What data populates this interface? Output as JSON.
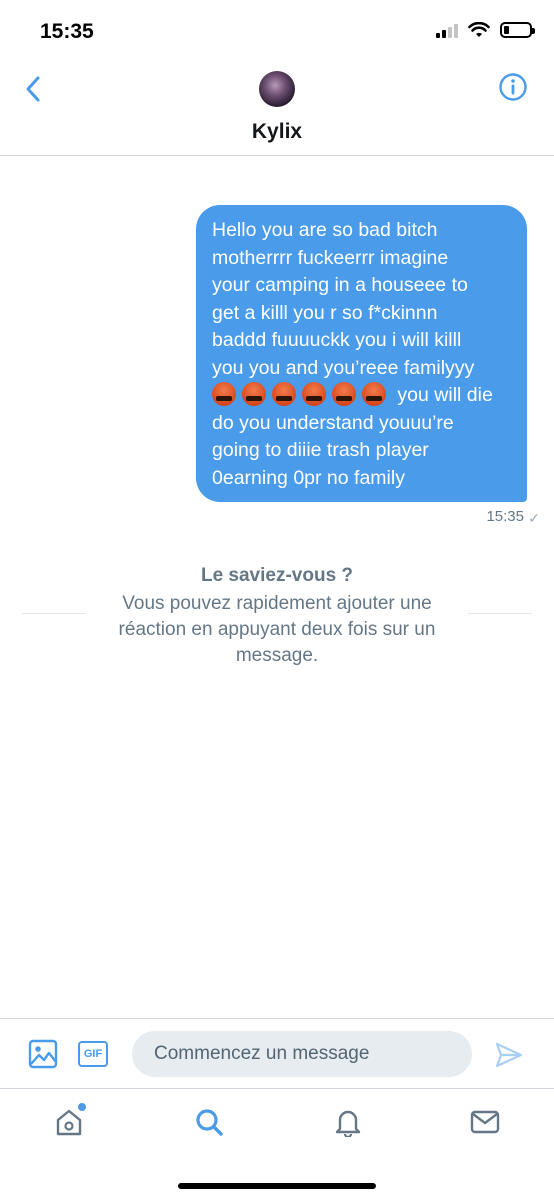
{
  "status_bar": {
    "time": "15:35"
  },
  "header": {
    "contact_name": "Kylix"
  },
  "message": {
    "lines": [
      "Hello you are so bad bitch",
      "motherrrr fuckeerrr imagine",
      "your camping in a houseee to",
      "get a killl you r so f*ckinnn",
      "baddd fuuuuckk you i will killl",
      "you you and you’reee familyyy",
      " you will die",
      "do you understand youuu’re",
      "going to diiie trash player",
      "0earning 0pr no family"
    ],
    "emoji_count": 6,
    "time": "15:35",
    "status_mark": "✓"
  },
  "tip": {
    "title": "Le saviez-vous ?",
    "body": "Vous pouvez rapidement ajouter une réaction en appuyant deux fois sur un message."
  },
  "composer": {
    "placeholder": "Commencez un message",
    "gif_label": "GIF"
  },
  "icons": {
    "back": "chevron-left-icon",
    "info": "info-icon",
    "media": "image-icon",
    "send": "send-icon",
    "tabs": [
      "home-icon",
      "search-icon",
      "bell-icon",
      "mail-icon"
    ]
  },
  "colors": {
    "accent": "#4a9be9",
    "bubble": "#4a9be9",
    "secondary_text": "#657786"
  }
}
